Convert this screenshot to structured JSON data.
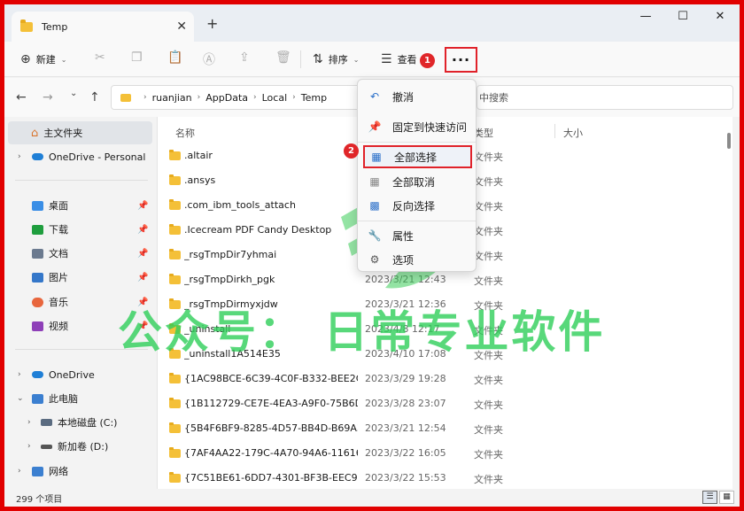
{
  "tab": {
    "title": "Temp",
    "close": "✕",
    "add": "+"
  },
  "window_controls": {
    "minimize": "—",
    "maximize": "☐",
    "close": "✕"
  },
  "toolbar": {
    "new_label": "新建",
    "sort_label": "排序",
    "view_label": "查看",
    "more_label": "···",
    "badge_1": "1"
  },
  "nav": {
    "back": "←",
    "forward": "→",
    "up_chevron": "⌄",
    "up": "↑",
    "breadcrumb": [
      "ruanjian",
      "AppData",
      "Local",
      "Temp"
    ],
    "search_placeholder": "中搜索"
  },
  "sidebar": {
    "home": "主文件夹",
    "onedrive_personal": "OneDrive - Personal",
    "quick": [
      {
        "label": "桌面",
        "color": "#3a8ee6"
      },
      {
        "label": "下载",
        "color": "#1f9e3e"
      },
      {
        "label": "文档",
        "color": "#6b7a8f"
      },
      {
        "label": "图片",
        "color": "#3477c9"
      },
      {
        "label": "音乐",
        "color": "#e8663d"
      },
      {
        "label": "视频",
        "color": "#8e3fb8"
      }
    ],
    "onedrive": "OneDrive",
    "this_pc": "此电脑",
    "drive_c": "本地磁盘 (C:)",
    "drive_d": "新加卷 (D:)",
    "network": "网络"
  },
  "columns": {
    "name": "名称",
    "type": "类型",
    "size": "大小"
  },
  "files": [
    {
      "name": ".altair",
      "date": "",
      "type": "文件夹"
    },
    {
      "name": ".ansys",
      "date": "",
      "type": "文件夹"
    },
    {
      "name": ".com_ibm_tools_attach",
      "date": "",
      "type": "文件夹"
    },
    {
      "name": ".Icecream PDF Candy Desktop",
      "date": "",
      "type": "文件夹"
    },
    {
      "name": "_rsgTmpDir7yhmai",
      "date": "",
      "type": "文件夹"
    },
    {
      "name": "_rsgTmpDirkh_pgk",
      "date": "2023/3/21 12:43",
      "type": "文件夹"
    },
    {
      "name": "_rsgTmpDirmyxjdw",
      "date": "2023/3/21 12:36",
      "type": "文件夹"
    },
    {
      "name": "_uninstall",
      "date": "2023/4/8 12:17",
      "type": "文件夹"
    },
    {
      "name": "_uninstall1A514E35",
      "date": "2023/4/10 17:08",
      "type": "文件夹"
    },
    {
      "name": "{1AC98BCE-6C39-4C0F-B332-BEE2C7...",
      "date": "2023/3/29 19:28",
      "type": "文件夹"
    },
    {
      "name": "{1B112729-CE7E-4EA3-A9F0-75B6D6...",
      "date": "2023/3/28 23:07",
      "type": "文件夹"
    },
    {
      "name": "{5B4F6BF9-8285-4D57-BB4D-B69A30...",
      "date": "2023/3/21 12:54",
      "type": "文件夹"
    },
    {
      "name": "{7AF4AA22-179C-4A70-94A6-11616...",
      "date": "2023/3/22 16:05",
      "type": "文件夹"
    },
    {
      "name": "{7C51BE61-6DD7-4301-BF3B-EEC95D...",
      "date": "2023/3/22 15:53",
      "type": "文件夹"
    }
  ],
  "status": {
    "count": "299 个项目"
  },
  "menu": {
    "items": [
      "撤消",
      "固定到快速访问",
      "全部选择",
      "全部取消",
      "反向选择",
      "属性",
      "选项"
    ],
    "badge_2": "2"
  },
  "watermark": {
    "text": "公众号： 日常专业软件"
  },
  "colors": {
    "annotation_red": "#e0222a",
    "watermark_green": "#2fcf5a",
    "folder_yellow": "#f4c038"
  }
}
